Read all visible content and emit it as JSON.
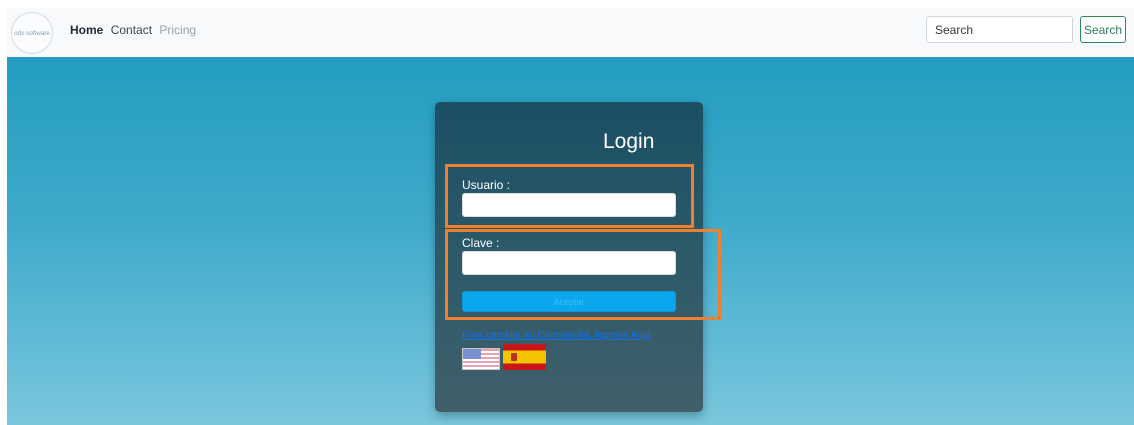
{
  "navbar": {
    "logo_text": "ods software",
    "links": [
      {
        "label": "Home"
      },
      {
        "label": "Contact"
      },
      {
        "label": "Pricing"
      }
    ],
    "search_placeholder": "Search",
    "search_button": "Search"
  },
  "login": {
    "title": "Login",
    "username_label": "Usuario :",
    "username_value": "",
    "password_label": "Clave :",
    "password_value": "",
    "submit_label": "Aceptar",
    "reset_link": "Para cambiar su Contraseña, Ingrese Aqui"
  },
  "languages": [
    {
      "icon": "us-flag-icon"
    },
    {
      "icon": "spain-flag-icon"
    }
  ],
  "colors": {
    "hero_top": "#239dc0",
    "hero_bottom": "#7ac7dd",
    "card": "#1b4f65",
    "submit": "#0aa7ef",
    "highlight": "#f08030",
    "search_accent": "#2e8b57"
  }
}
